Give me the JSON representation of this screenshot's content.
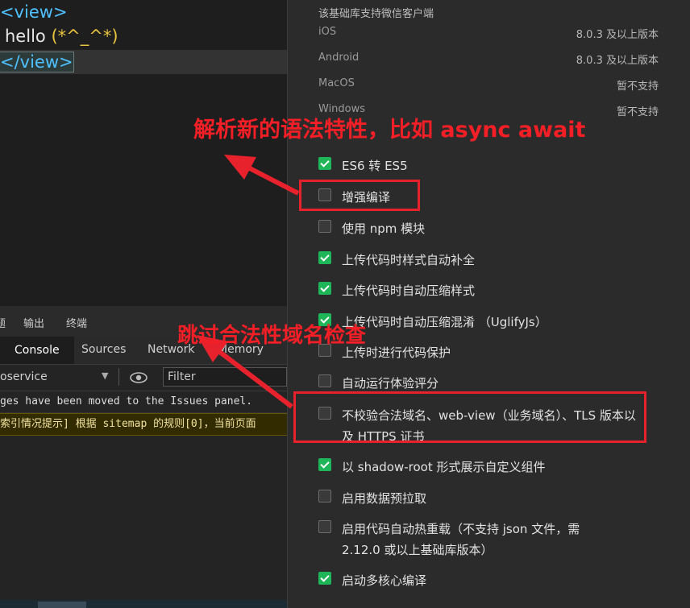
{
  "editor": {
    "line1": "<view>",
    "line2_text": "hello",
    "line2_paren": "(*^_^*)",
    "line3": "</view>"
  },
  "devtools": {
    "top_tabs": [
      "题",
      "输出",
      "终端"
    ],
    "tabs": [
      "Console",
      "Sources",
      "Network",
      "Memory"
    ],
    "active_tab": "Console",
    "context": "oservice",
    "filter_placeholder": "Filter",
    "messages": [
      "ges have been moved to the Issues panel.",
      "索引情况提示] 根据 sitemap 的规则[0]，当前页面"
    ]
  },
  "settings": {
    "header": "该基础库支持微信客户端",
    "platforms": [
      {
        "name": "iOS",
        "value": "8.0.3 及以上版本"
      },
      {
        "name": "Android",
        "value": "8.0.3 及以上版本"
      },
      {
        "name": "MacOS",
        "value": "暂不支持"
      },
      {
        "name": "Windows",
        "value": "暂不支持"
      }
    ],
    "options": [
      {
        "label": "ES6 转 ES5",
        "checked": true
      },
      {
        "label": "增强编译",
        "checked": false
      },
      {
        "label": "使用 npm 模块",
        "checked": false
      },
      {
        "label": "上传代码时样式自动补全",
        "checked": true
      },
      {
        "label": "上传代码时自动压缩样式",
        "checked": true
      },
      {
        "label": "上传代码时自动压缩混淆 （UglifyJs）",
        "checked": true
      },
      {
        "label": "上传时进行代码保护",
        "checked": false
      },
      {
        "label": "自动运行体验评分",
        "checked": false
      },
      {
        "label": "不校验合法域名、web-view（业务域名）、TLS 版本以及 HTTPS 证书",
        "checked": false
      },
      {
        "label": "以 shadow-root 形式展示自定义组件",
        "checked": true
      },
      {
        "label": "启用数据预拉取",
        "checked": false
      },
      {
        "label": "启用代码自动热重载（不支持 json 文件，需 2.12.0 或以上基础库版本）",
        "checked": false
      },
      {
        "label": "启动多核心编译",
        "checked": true
      }
    ]
  },
  "annotations": {
    "top": "解析新的语法特性，比如 async await",
    "middle": "跳过合法性域名检查"
  },
  "colors": {
    "annotation_red": "#f21f27",
    "checkbox_green": "#1fb559"
  }
}
